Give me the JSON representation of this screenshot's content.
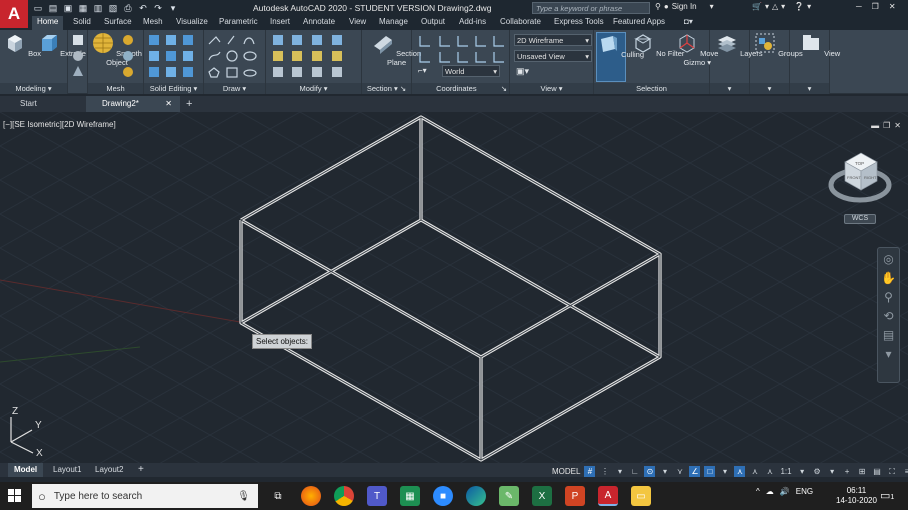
{
  "app": {
    "logo": "A",
    "title": "Autodesk AutoCAD 2020 - STUDENT VERSION   Drawing2.dwg",
    "search_placeholder": "Type a keyword or phrase",
    "sign_in": "Sign In",
    "accent_color": "#c8252d"
  },
  "menu_tabs": [
    "Home",
    "Solid",
    "Surface",
    "Mesh",
    "Visualize",
    "Parametric",
    "Insert",
    "Annotate",
    "View",
    "Manage",
    "Output",
    "Add-ins",
    "Collaborate",
    "Express Tools",
    "Featured Apps"
  ],
  "ribbon": {
    "modeling": {
      "label": "Modeling",
      "box": "Box",
      "extrude": "Extrude"
    },
    "mesh": {
      "label": "Mesh",
      "smooth_object_1": "Smooth",
      "smooth_object_2": "Object"
    },
    "solid_editing": {
      "label": "Solid Editing"
    },
    "draw": {
      "label": "Draw"
    },
    "modify": {
      "label": "Modify"
    },
    "section": {
      "label": "Section",
      "section_plane_1": "Section",
      "section_plane_2": "Plane"
    },
    "coordinates": {
      "label": "Coordinates",
      "world": "World"
    },
    "view": {
      "label": "View",
      "visual_style": "2D Wireframe",
      "saved_view": "Unsaved View"
    },
    "selection": {
      "label": "Selection",
      "culling": "Culling",
      "no_filter": "No Filter",
      "move_gizmo_1": "Move",
      "move_gizmo_2": "Gizmo"
    },
    "layers": "Layers",
    "groups": "Groups",
    "view_btn": "View"
  },
  "doc_tabs": {
    "start": "Start",
    "drawing": "Drawing2*"
  },
  "viewport": {
    "label": "[−][SE Isometric][2D Wireframe]",
    "tooltip": "Select objects:",
    "wcs": "WCS",
    "ucs_x": "X",
    "ucs_y": "Y",
    "ucs_z": "Z",
    "viewcube_top": "TOP",
    "viewcube_front": "FRONT",
    "viewcube_right": "RIGHT"
  },
  "layout_tabs": [
    "Model",
    "Layout1",
    "Layout2"
  ],
  "status": {
    "model": "MODEL",
    "scale": "1:1"
  },
  "taskbar": {
    "search_placeholder": "Type here to search",
    "language": "ENG",
    "time": "06:11",
    "date": "14-10-2020",
    "notifications": "1"
  }
}
